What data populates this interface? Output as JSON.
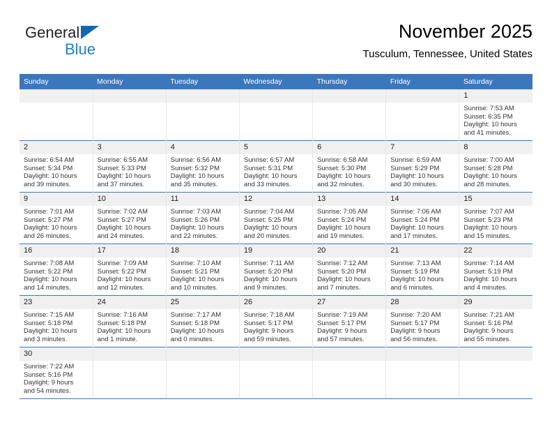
{
  "brand": {
    "name_top": "General",
    "name_bottom": "Blue",
    "color_blue": "#1b7fc4",
    "color_triangle": "#1167b1"
  },
  "header": {
    "title": "November 2025",
    "subtitle": "Tusculum, Tennessee, United States"
  },
  "theme": {
    "header_blue": "#3b77bd",
    "daynum_band": "#f0f0f0",
    "row_line": "#3b77bd"
  },
  "weekdays": [
    "Sunday",
    "Monday",
    "Tuesday",
    "Wednesday",
    "Thursday",
    "Friday",
    "Saturday"
  ],
  "weeks": [
    [
      {
        "day": "",
        "sunrise": "",
        "sunset": "",
        "daylight1": "",
        "daylight2": "",
        "blank": true
      },
      {
        "day": "",
        "sunrise": "",
        "sunset": "",
        "daylight1": "",
        "daylight2": "",
        "blank": true
      },
      {
        "day": "",
        "sunrise": "",
        "sunset": "",
        "daylight1": "",
        "daylight2": "",
        "blank": true
      },
      {
        "day": "",
        "sunrise": "",
        "sunset": "",
        "daylight1": "",
        "daylight2": "",
        "blank": true
      },
      {
        "day": "",
        "sunrise": "",
        "sunset": "",
        "daylight1": "",
        "daylight2": "",
        "blank": true
      },
      {
        "day": "",
        "sunrise": "",
        "sunset": "",
        "daylight1": "",
        "daylight2": "",
        "blank": true
      },
      {
        "day": "1",
        "sunrise": "Sunrise: 7:53 AM",
        "sunset": "Sunset: 6:35 PM",
        "daylight1": "Daylight: 10 hours",
        "daylight2": "and 41 minutes.",
        "blank": false
      }
    ],
    [
      {
        "day": "2",
        "sunrise": "Sunrise: 6:54 AM",
        "sunset": "Sunset: 5:34 PM",
        "daylight1": "Daylight: 10 hours",
        "daylight2": "and 39 minutes.",
        "blank": false
      },
      {
        "day": "3",
        "sunrise": "Sunrise: 6:55 AM",
        "sunset": "Sunset: 5:33 PM",
        "daylight1": "Daylight: 10 hours",
        "daylight2": "and 37 minutes.",
        "blank": false
      },
      {
        "day": "4",
        "sunrise": "Sunrise: 6:56 AM",
        "sunset": "Sunset: 5:32 PM",
        "daylight1": "Daylight: 10 hours",
        "daylight2": "and 35 minutes.",
        "blank": false
      },
      {
        "day": "5",
        "sunrise": "Sunrise: 6:57 AM",
        "sunset": "Sunset: 5:31 PM",
        "daylight1": "Daylight: 10 hours",
        "daylight2": "and 33 minutes.",
        "blank": false
      },
      {
        "day": "6",
        "sunrise": "Sunrise: 6:58 AM",
        "sunset": "Sunset: 5:30 PM",
        "daylight1": "Daylight: 10 hours",
        "daylight2": "and 32 minutes.",
        "blank": false
      },
      {
        "day": "7",
        "sunrise": "Sunrise: 6:59 AM",
        "sunset": "Sunset: 5:29 PM",
        "daylight1": "Daylight: 10 hours",
        "daylight2": "and 30 minutes.",
        "blank": false
      },
      {
        "day": "8",
        "sunrise": "Sunrise: 7:00 AM",
        "sunset": "Sunset: 5:28 PM",
        "daylight1": "Daylight: 10 hours",
        "daylight2": "and 28 minutes.",
        "blank": false
      }
    ],
    [
      {
        "day": "9",
        "sunrise": "Sunrise: 7:01 AM",
        "sunset": "Sunset: 5:27 PM",
        "daylight1": "Daylight: 10 hours",
        "daylight2": "and 26 minutes.",
        "blank": false
      },
      {
        "day": "10",
        "sunrise": "Sunrise: 7:02 AM",
        "sunset": "Sunset: 5:27 PM",
        "daylight1": "Daylight: 10 hours",
        "daylight2": "and 24 minutes.",
        "blank": false
      },
      {
        "day": "11",
        "sunrise": "Sunrise: 7:03 AM",
        "sunset": "Sunset: 5:26 PM",
        "daylight1": "Daylight: 10 hours",
        "daylight2": "and 22 minutes.",
        "blank": false
      },
      {
        "day": "12",
        "sunrise": "Sunrise: 7:04 AM",
        "sunset": "Sunset: 5:25 PM",
        "daylight1": "Daylight: 10 hours",
        "daylight2": "and 20 minutes.",
        "blank": false
      },
      {
        "day": "13",
        "sunrise": "Sunrise: 7:05 AM",
        "sunset": "Sunset: 5:24 PM",
        "daylight1": "Daylight: 10 hours",
        "daylight2": "and 19 minutes.",
        "blank": false
      },
      {
        "day": "14",
        "sunrise": "Sunrise: 7:06 AM",
        "sunset": "Sunset: 5:24 PM",
        "daylight1": "Daylight: 10 hours",
        "daylight2": "and 17 minutes.",
        "blank": false
      },
      {
        "day": "15",
        "sunrise": "Sunrise: 7:07 AM",
        "sunset": "Sunset: 5:23 PM",
        "daylight1": "Daylight: 10 hours",
        "daylight2": "and 15 minutes.",
        "blank": false
      }
    ],
    [
      {
        "day": "16",
        "sunrise": "Sunrise: 7:08 AM",
        "sunset": "Sunset: 5:22 PM",
        "daylight1": "Daylight: 10 hours",
        "daylight2": "and 14 minutes.",
        "blank": false
      },
      {
        "day": "17",
        "sunrise": "Sunrise: 7:09 AM",
        "sunset": "Sunset: 5:22 PM",
        "daylight1": "Daylight: 10 hours",
        "daylight2": "and 12 minutes.",
        "blank": false
      },
      {
        "day": "18",
        "sunrise": "Sunrise: 7:10 AM",
        "sunset": "Sunset: 5:21 PM",
        "daylight1": "Daylight: 10 hours",
        "daylight2": "and 10 minutes.",
        "blank": false
      },
      {
        "day": "19",
        "sunrise": "Sunrise: 7:11 AM",
        "sunset": "Sunset: 5:20 PM",
        "daylight1": "Daylight: 10 hours",
        "daylight2": "and 9 minutes.",
        "blank": false
      },
      {
        "day": "20",
        "sunrise": "Sunrise: 7:12 AM",
        "sunset": "Sunset: 5:20 PM",
        "daylight1": "Daylight: 10 hours",
        "daylight2": "and 7 minutes.",
        "blank": false
      },
      {
        "day": "21",
        "sunrise": "Sunrise: 7:13 AM",
        "sunset": "Sunset: 5:19 PM",
        "daylight1": "Daylight: 10 hours",
        "daylight2": "and 6 minutes.",
        "blank": false
      },
      {
        "day": "22",
        "sunrise": "Sunrise: 7:14 AM",
        "sunset": "Sunset: 5:19 PM",
        "daylight1": "Daylight: 10 hours",
        "daylight2": "and 4 minutes.",
        "blank": false
      }
    ],
    [
      {
        "day": "23",
        "sunrise": "Sunrise: 7:15 AM",
        "sunset": "Sunset: 5:18 PM",
        "daylight1": "Daylight: 10 hours",
        "daylight2": "and 3 minutes.",
        "blank": false
      },
      {
        "day": "24",
        "sunrise": "Sunrise: 7:16 AM",
        "sunset": "Sunset: 5:18 PM",
        "daylight1": "Daylight: 10 hours",
        "daylight2": "and 1 minute.",
        "blank": false
      },
      {
        "day": "25",
        "sunrise": "Sunrise: 7:17 AM",
        "sunset": "Sunset: 5:18 PM",
        "daylight1": "Daylight: 10 hours",
        "daylight2": "and 0 minutes.",
        "blank": false
      },
      {
        "day": "26",
        "sunrise": "Sunrise: 7:18 AM",
        "sunset": "Sunset: 5:17 PM",
        "daylight1": "Daylight: 9 hours",
        "daylight2": "and 59 minutes.",
        "blank": false
      },
      {
        "day": "27",
        "sunrise": "Sunrise: 7:19 AM",
        "sunset": "Sunset: 5:17 PM",
        "daylight1": "Daylight: 9 hours",
        "daylight2": "and 57 minutes.",
        "blank": false
      },
      {
        "day": "28",
        "sunrise": "Sunrise: 7:20 AM",
        "sunset": "Sunset: 5:17 PM",
        "daylight1": "Daylight: 9 hours",
        "daylight2": "and 56 minutes.",
        "blank": false
      },
      {
        "day": "29",
        "sunrise": "Sunrise: 7:21 AM",
        "sunset": "Sunset: 5:16 PM",
        "daylight1": "Daylight: 9 hours",
        "daylight2": "and 55 minutes.",
        "blank": false
      }
    ],
    [
      {
        "day": "30",
        "sunrise": "Sunrise: 7:22 AM",
        "sunset": "Sunset: 5:16 PM",
        "daylight1": "Daylight: 9 hours",
        "daylight2": "and 54 minutes.",
        "blank": false
      },
      {
        "day": "",
        "sunrise": "",
        "sunset": "",
        "daylight1": "",
        "daylight2": "",
        "blank": true
      },
      {
        "day": "",
        "sunrise": "",
        "sunset": "",
        "daylight1": "",
        "daylight2": "",
        "blank": true
      },
      {
        "day": "",
        "sunrise": "",
        "sunset": "",
        "daylight1": "",
        "daylight2": "",
        "blank": true
      },
      {
        "day": "",
        "sunrise": "",
        "sunset": "",
        "daylight1": "",
        "daylight2": "",
        "blank": true
      },
      {
        "day": "",
        "sunrise": "",
        "sunset": "",
        "daylight1": "",
        "daylight2": "",
        "blank": true
      },
      {
        "day": "",
        "sunrise": "",
        "sunset": "",
        "daylight1": "",
        "daylight2": "",
        "blank": true
      }
    ]
  ]
}
